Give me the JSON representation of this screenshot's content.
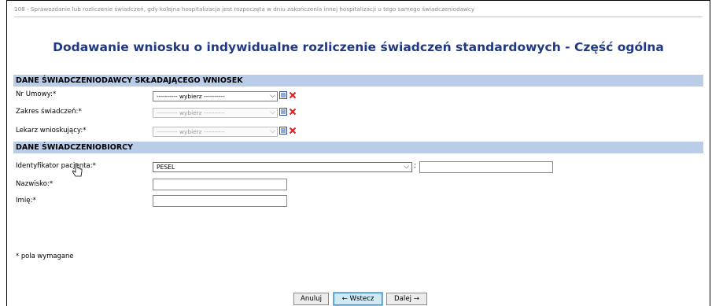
{
  "breadcrumb": "108 - Sprawozdanie lub rozliczenie świadczeń, gdy kolejna hospitalizacja jest rozpoczęta w dniu zakończenia innej hospitalizacji u tego samego świadczeniodawcy",
  "page_title": "Dodawanie wniosku o indywidualne rozliczenie świadczeń standardowych - Część ogólna",
  "section_provider": {
    "header": "DANE ŚWIADCZENIODAWCY SKŁADAJĄCEGO WNIOSEK",
    "fields": [
      {
        "label": "Nr Umowy:*",
        "value": "---------- wybierz ----------",
        "disabled": false
      },
      {
        "label": "Zakres świadczeń:*",
        "value": "---------- wybierz ----------",
        "disabled": true
      },
      {
        "label": "Lekarz wnioskujący:*",
        "value": "---------- wybierz ----------",
        "disabled": true
      }
    ]
  },
  "section_patient": {
    "header": "DANE ŚWIADCZENIOBIORCY",
    "identifier_label": "Identyfikator pacjenta:*",
    "identifier_type": "PESEL",
    "identifier_value": "",
    "lastname_label": "Nazwisko:*",
    "lastname_value": "",
    "firstname_label": "Imię:*",
    "firstname_value": ""
  },
  "required_note": "* pola wymagane",
  "buttons": {
    "cancel": "Anuluj",
    "back": "← Wstecz",
    "next": "Dalej →"
  },
  "colors": {
    "title": "#1f3a82",
    "section_bg": "#b9cde8",
    "delete_x": "#e02020",
    "list_icon": "#2a4f9e"
  },
  "icons": {
    "list": "list-icon",
    "delete": "delete-x-icon",
    "dropdown": "chevron-down-icon"
  }
}
